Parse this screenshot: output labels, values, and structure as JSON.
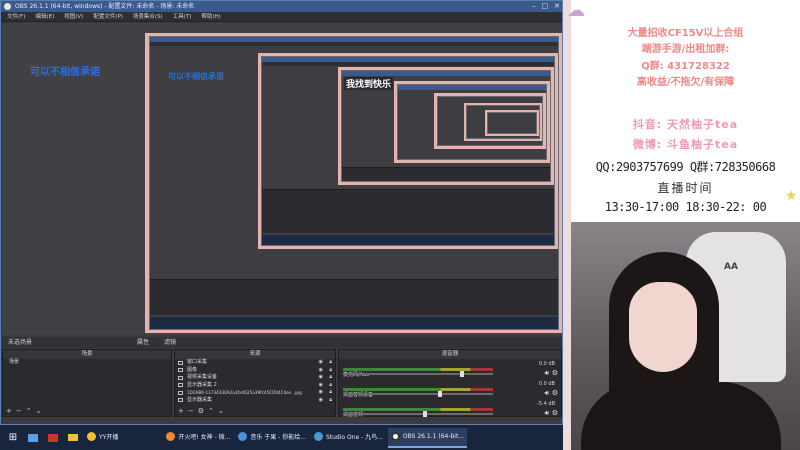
{
  "window": {
    "title": "OBS 26.1.1 (64-bit, windows) - 配置文件: 未命名 - 场景: 未命名",
    "menu": [
      "文件(F)",
      "编辑(E)",
      "视图(V)",
      "配置文件(P)",
      "场景集合(S)",
      "工具(T)",
      "帮助(H)"
    ]
  },
  "preview": {
    "overlay_left": "可以不相信承诺",
    "overlay_nested": "可以不相信承诺",
    "overlay_center": "我找到快乐"
  },
  "scene_transition_label": "未选场景",
  "transition_buttons": [
    "属性",
    "滤镜"
  ],
  "docks": {
    "scenes": {
      "header": "场景",
      "items": [
        "场景"
      ]
    },
    "sources": {
      "header": "来源",
      "items": [
        "窗口采集",
        "图像",
        "视频采集设备",
        "显示器采集 2",
        "1D2AB0-11734330A2a3fa4625a39fc45CD04C4ex...jpg",
        "显示器采集"
      ]
    },
    "mixer": {
      "header": "混音器",
      "rows": [
        {
          "label": "麦克风/Aux",
          "db": "0.0 dB",
          "level": 0.8
        },
        {
          "label": "桌面音频设备",
          "db": "0.0 dB",
          "level": 0.65
        },
        {
          "label": "桌面音频",
          "db": "-5.4 dB",
          "level": 0.55
        }
      ]
    }
  },
  "taskbar": {
    "tasks": [
      {
        "label": "YY开播",
        "color": "#f2c230",
        "active": false
      },
      {
        "label": "开火吧! 女神 - 微...",
        "color": "#f08a2a",
        "active": false
      },
      {
        "label": "音乐 于果 - 你能给...",
        "color": "#4a8ee0",
        "active": false
      },
      {
        "label": "Studio One - 九鸟...",
        "color": "#3fa0d8",
        "active": false
      },
      {
        "label": "OBS 26.1.1 (64-bit...",
        "color": "#ffffff",
        "active": true
      }
    ]
  },
  "info_card": {
    "line1": "大量招收CF15V以上合组",
    "line2": "端游手游/出租加群:",
    "line3": "Q群: 431728322",
    "line4": "高收益/不拖欠/有保障",
    "line5": "抖音: 天然柚子tea",
    "line6": "微博: 斗鱼柚子tea",
    "line7": "QQ:2903757699 Q群:728350668",
    "line8": "直播时间",
    "line9": "13:30-17:00 18:30-22: 00"
  },
  "webcam": {
    "chair_mark": "AA"
  },
  "colors": {
    "accent": "#3a5a8c",
    "pink_text": "#ef9bb0",
    "red_text": "#ef8a8a",
    "preview_text": "#2b6fe0"
  }
}
